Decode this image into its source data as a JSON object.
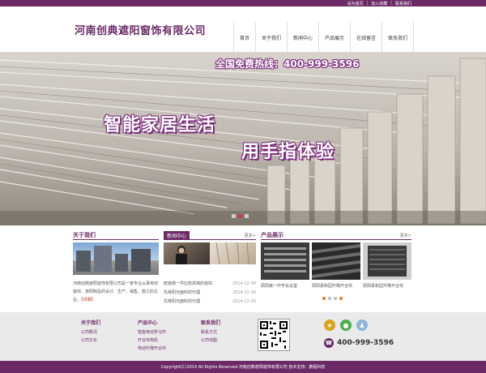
{
  "top_links": [
    "设为首页",
    "加入收藏",
    "联系我们"
  ],
  "logo": "河南创典遮阳窗饰有限公司",
  "nav": [
    "首页",
    "关于我们",
    "新闻中心",
    "产品展示",
    "在线留言",
    "联系我们"
  ],
  "hero": {
    "hotline": "全国免费热线：400-999-3596",
    "slogan1": "智能家居生活",
    "slogan2": "用手指体验"
  },
  "about": {
    "title": "关于我们",
    "text": "河南创典遮阳窗饰有限公司是一家专业从事电动窗帘、遮阳制品的设计、生产、销售、施工的企业。",
    "detail": "【详细】"
  },
  "news": {
    "title": "新闻中心",
    "more": "更多>",
    "items": [
      {
        "title": "欧窗南一件比较高档的窗帘",
        "date": "2014-12-30"
      },
      {
        "title": "先锋阳光面料的代理",
        "date": "2014-12-30"
      },
      {
        "title": "先锋阳光面料的代理",
        "date": "2014-12-30"
      }
    ]
  },
  "products": {
    "title": "产品展示",
    "more": "更多>",
    "items": [
      {
        "caption": "硕阳第一中学会议室"
      },
      {
        "caption": "硕阳豪和园升降开合帘"
      },
      {
        "caption": "硕阳豪和园升降开合帘"
      }
    ]
  },
  "footer": {
    "cols": [
      {
        "heading": "关于我们",
        "links": [
          "公司概况",
          "公司文化"
        ]
      },
      {
        "heading": "产品中心",
        "links": [
          "智能电动罗马杆",
          "开合帘电机",
          "电动升降开合帘"
        ]
      },
      {
        "heading": "联系我们",
        "links": [
          "联系方式",
          "公司地图"
        ]
      }
    ],
    "phone": "400-999-3596"
  },
  "copyright": "Copyright(C)2014 All Rights Reserved 河南创典遮阳窗饰有限公司 技术支持：鹏程科技",
  "colors": {
    "brand": "#6b2a66",
    "accent": "#c0392b"
  }
}
